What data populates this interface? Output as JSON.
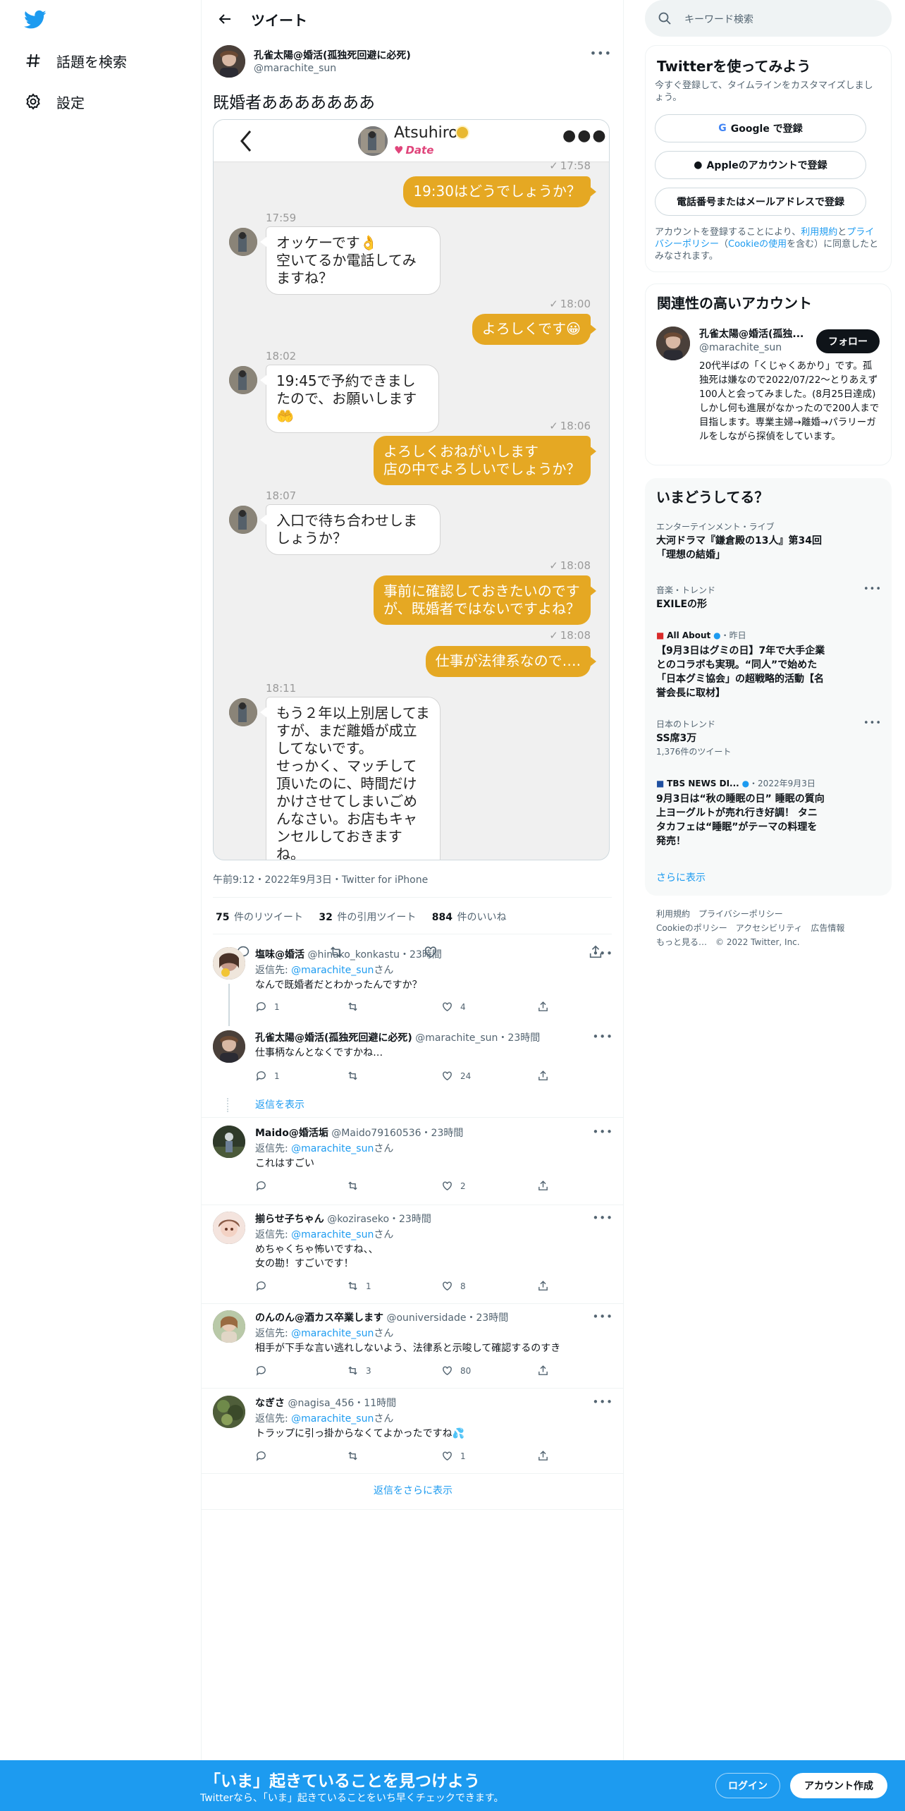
{
  "nav": {
    "explore_label": "話題を検索",
    "settings_label": "設定"
  },
  "header": {
    "title": "ツイート"
  },
  "tweet": {
    "author_name": "孔雀太陽@婚活(孤独死回避に必死)",
    "author_handle": "@marachite_sun",
    "text": "既婚者あああああああ",
    "meta": "午前9:12・2022年9月3日・Twitter for iPhone",
    "retweets_count": "75",
    "retweets_label": "件のリツイート",
    "quotes_count": "32",
    "quotes_label": "件の引用ツイート",
    "likes_count": "884",
    "likes_label": "件のいいね"
  },
  "chat": {
    "partner_name": "Atsuhiro",
    "partner_status": "Date",
    "messages": [
      {
        "time": "17:58",
        "text": "19:30はどうでしょうか？"
      },
      {
        "time": "17:59",
        "text": "オッケーです👌\n空いてるか電話してみますね？"
      },
      {
        "time": "18:00",
        "text": "よろしくです😀"
      },
      {
        "time": "18:02",
        "text": "19:45で予約できましたので、お願いします🤲"
      },
      {
        "time": "18:06",
        "text": "よろしくおねがいします\n店の中でよろしいでしょうか？"
      },
      {
        "time": "18:07",
        "text": "入口で待ち合わせしましょうか？"
      },
      {
        "time": "18:08",
        "text": "事前に確認しておきたいのですが、既婚者ではないですよね？"
      },
      {
        "time": "18:08",
        "text": "仕事が法律系なので…."
      },
      {
        "time": "18:11",
        "text": "もう２年以上別居してますが、まだ離婚が成立してないです。\nせっかく、マッチして頂いたのに、時間だけかけさせてしまいごめんなさい。お店もキャンセルしておきますね。"
      }
    ]
  },
  "replies": [
    {
      "name": "塩味@婚活",
      "handle": "@hinako_konkastu",
      "age": "23時間",
      "to_label": "返信先:",
      "to": "@marachite_sun",
      "to_suffix": "さん",
      "text": "なんで既婚者だとわかったんですか？",
      "replies": "1",
      "retweets": "",
      "likes": "4"
    },
    {
      "name": "孔雀太陽@婚活(孤独死回避に必死)",
      "handle": "@marachite_sun",
      "age": "23時間",
      "text": "仕事柄なんとなくですかね…",
      "replies": "1",
      "retweets": "",
      "likes": "24",
      "show_replies": "返信を表示"
    },
    {
      "name": "Maido@婚活垢",
      "handle": "@Maido79160536",
      "age": "23時間",
      "to_label": "返信先:",
      "to": "@marachite_sun",
      "to_suffix": "さん",
      "text": "これはすごい",
      "replies": "",
      "retweets": "",
      "likes": "2"
    },
    {
      "name": "揃らせ子ちゃん",
      "handle": "@koziraseko",
      "age": "23時間",
      "to_label": "返信先:",
      "to": "@marachite_sun",
      "to_suffix": "さん",
      "text": "めちゃくちゃ怖いですね、、\n女の勘！すごいです！",
      "replies": "",
      "retweets": "1",
      "likes": "8"
    },
    {
      "name": "のんのん@酒カス卒業します",
      "handle": "@ouniversidade",
      "age": "23時間",
      "to_label": "返信先:",
      "to": "@marachite_sun",
      "to_suffix": "さん",
      "text": "相手が下手な言い逃れしないよう、法律系と示唆して確認するのすき",
      "replies": "",
      "retweets": "3",
      "likes": "80"
    },
    {
      "name": "なぎさ",
      "handle": "@nagisa_456",
      "age": "11時間",
      "to_label": "返信先:",
      "to": "@marachite_sun",
      "to_suffix": "さん",
      "text": "トラップに引っ掛からなくてよかったですね💦",
      "replies": "",
      "retweets": "",
      "likes": "1"
    }
  ],
  "more_replies": "返信をさらに表示",
  "sidebar": {
    "search_placeholder": "キーワード検索",
    "signup": {
      "title": "Twitterを使ってみよう",
      "subtitle": "今すぐ登録して、タイムラインをカスタマイズしましょう。",
      "google_btn": "Google で登録",
      "apple_btn": "Appleのアカウントで登録",
      "phone_btn": "電話番号またはメールアドレスで登録",
      "terms_pre": "アカウントを登録することにより、",
      "terms_link": "利用規約",
      "terms_mid": "と",
      "privacy_link": "プライバシーポリシー",
      "terms_mid2": "（",
      "cookie_link": "Cookieの使用",
      "terms_post": "を含む）に同意したとみなされます。"
    },
    "related": {
      "title": "関連性の高いアカウント",
      "name": "孔雀太陽@婚活(孤独...",
      "handle": "@marachite_sun",
      "follow": "フォロー",
      "bio": "20代半ばの「くじゃくあかり」です。孤独死は嫌なので2022/07/22〜とりあえず100人と会ってみました。(8月25日達成)しかし何も進展がなかったので200人まで目指します。専業主婦→離婚→パラリーガルをしながら探偵をしています。"
    },
    "trends": {
      "title": "いまどうしてる？",
      "items": [
        {
          "cat": "エンターテインメント・ライブ",
          "title": "大河ドラマ『鎌倉殿の13人』第34回「理想の結婚」"
        },
        {
          "cat": "音楽・トレンド",
          "title": "EXILEの形"
        },
        {
          "cat": "All About",
          "cat_suffix": "・昨日",
          "title": "【9月3日はグミの日】7年で大手企業とのコラボも実現。“同人”で始めた「日本グミ協会」の超戦略的活動【名誉会長に取材】"
        },
        {
          "cat": "日本のトレンド",
          "title": "SS席3万",
          "count": "1,376件のツイート"
        },
        {
          "cat": "TBS NEWS DI...",
          "cat_suffix": "・2022年9月3日",
          "title": "9月3日は“秋の睡眠の日” 睡眠の質向上ヨーグルトが売れ行き好調！ タニタカフェは“睡眠”がテーマの料理を発売！"
        }
      ],
      "show_more": "さらに表示"
    },
    "footer": {
      "terms": "利用規約",
      "privacy": "プライバシーポリシー",
      "cookie": "Cookieのポリシー",
      "accessibility": "アクセシビリティ",
      "ads": "広告情報",
      "more": "もっと見る…",
      "copyright": "© 2022 Twitter, Inc."
    }
  },
  "bottom_bar": {
    "title": "「いま」起きていることを見つけよう",
    "subtitle": "Twitterなら、「いま」起きていることをいち早くチェックできます。",
    "login": "ログイン",
    "signup": "アカウント作成"
  },
  "colors": {
    "accent": "#1d9bf0",
    "bubble_orange": "#e5a823",
    "date_pink": "#e0457b"
  }
}
